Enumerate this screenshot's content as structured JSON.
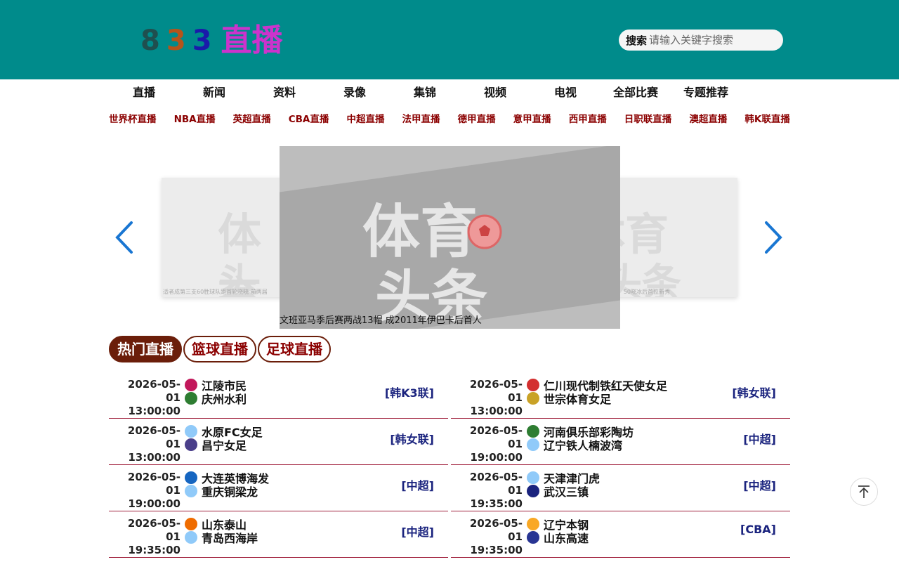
{
  "header": {
    "logo": {
      "d1": "8",
      "d2": "3",
      "d3": "3",
      "cn": "直播"
    },
    "search": {
      "label": "搜索",
      "placeholder": "请输入关键字搜索"
    }
  },
  "nav": [
    "直播",
    "新闻",
    "资料",
    "录像",
    "集锦",
    "视频",
    "电视",
    "全部比赛",
    "专题推荐"
  ],
  "subnav": [
    "世界杯直播",
    "NBA直播",
    "英超直播",
    "CBA直播",
    "中超直播",
    "法甲直播",
    "德甲直播",
    "意甲直播",
    "西甲直播",
    "日职联直播",
    "澳超直播",
    "韩K联直播"
  ],
  "carousel": {
    "caption": "文班亚马季后赛两战13帽 成2011年伊巴卡后首人",
    "left_caption": "适者成第三支60胜球队距首轮晓晓 前两届",
    "right_caption": "50晓冰后首位新秀",
    "overlay_text_1": "体育",
    "overlay_text_2": "头条"
  },
  "tabs": [
    "热门直播",
    "篮球直播",
    "足球直播"
  ],
  "matches": [
    {
      "date": "2026-05-01",
      "time": "13:00:00",
      "home": "江陵市民",
      "away": "庆州水利",
      "league": "[韩K3联]",
      "home_icon": "#c2185b",
      "away_icon": "#2e7d32"
    },
    {
      "date": "2026-05-01",
      "time": "13:00:00",
      "home": "仁川现代制铁红天使女足",
      "away": "世宗体育女足",
      "league": "[韩女联]",
      "home_icon": "#d32f2f",
      "away_icon": "#c9a227"
    },
    {
      "date": "2026-05-01",
      "time": "13:00:00",
      "home": "水原FC女足",
      "away": "昌宁女足",
      "league": "[韩女联]",
      "home_icon": "#90caf9",
      "away_icon": "#4a3f8a"
    },
    {
      "date": "2026-05-01",
      "time": "19:00:00",
      "home": "河南俱乐部彩陶坊",
      "away": "辽宁铁人楠波湾",
      "league": "[中超]",
      "home_icon": "#2e7d32",
      "away_icon": "#90caf9"
    },
    {
      "date": "2026-05-01",
      "time": "19:00:00",
      "home": "大连英博海发",
      "away": "重庆铜梁龙",
      "league": "[中超]",
      "home_icon": "#1565c0",
      "away_icon": "#90caf9"
    },
    {
      "date": "2026-05-01",
      "time": "19:35:00",
      "home": "天津津门虎",
      "away": "武汉三镇",
      "league": "[中超]",
      "home_icon": "#90caf9",
      "away_icon": "#1a237e"
    },
    {
      "date": "2026-05-01",
      "time": "19:35:00",
      "home": "山东泰山",
      "away": "青岛西海岸",
      "league": "[中超]",
      "home_icon": "#ef6c00",
      "away_icon": "#90caf9"
    },
    {
      "date": "2026-05-01",
      "time": "19:35:00",
      "home": "辽宁本钢",
      "away": "山东高速",
      "league": "[CBA]",
      "home_icon": "#f9a825",
      "away_icon": "#283593"
    }
  ],
  "colors": {
    "header_bg": "#008b8b",
    "subnav_text": "#8b0000",
    "tab_active": "#6b1e0a",
    "league_text": "#1a237e",
    "divider": "#a0203c",
    "logo_d1": "#1f4f4f",
    "logo_d2": "#b5541a",
    "logo_d3": "#1a1aaa",
    "logo_cn": "#cc33cc"
  }
}
